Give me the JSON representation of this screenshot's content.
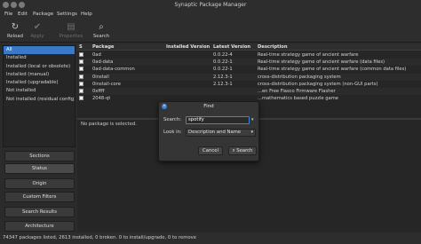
{
  "window": {
    "title": "Synaptic Package Manager"
  },
  "menu": [
    "File",
    "Edit",
    "Package",
    "Settings",
    "Help"
  ],
  "toolbar": {
    "reload": "Reload",
    "apply": "Apply",
    "properties": "Properties",
    "search": "Search"
  },
  "filters": [
    "All",
    "Installed",
    "Installed (local or obsolete)",
    "Installed (manual)",
    "Installed (upgradable)",
    "Not installed",
    "Not installed (residual config)"
  ],
  "left_buttons": [
    "Sections",
    "Status",
    "Origin",
    "Custom Filters",
    "Search Results",
    "Architecture"
  ],
  "table": {
    "headers": {
      "s": "S",
      "package": "Package",
      "installed": "Installed Version",
      "latest": "Latest Version",
      "description": "Description"
    },
    "rows": [
      {
        "package": "0ad",
        "installed": "",
        "latest": "0.0.22-4",
        "description": "Real-time strategy game of ancient warfare"
      },
      {
        "package": "0ad-data",
        "installed": "",
        "latest": "0.0.22-1",
        "description": "Real-time strategy game of ancient warfare (data files)"
      },
      {
        "package": "0ad-data-common",
        "installed": "",
        "latest": "0.0.22-1",
        "description": "Real-time strategy game of ancient warfare (common data files)"
      },
      {
        "package": "0install",
        "installed": "",
        "latest": "2.12.3-1",
        "description": "cross-distribution packaging system"
      },
      {
        "package": "0install-core",
        "installed": "",
        "latest": "2.12.3-1",
        "description": "cross-distribution packaging system (non-GUI parts)"
      },
      {
        "package": "0xffff",
        "installed": "",
        "latest": "",
        "description": "...en Free Fiasco Firmware Flasher"
      },
      {
        "package": "2048-qt",
        "installed": "",
        "latest": "",
        "description": "...mathematics based puzzle game"
      }
    ]
  },
  "description_pane": {
    "text": "No package is selected."
  },
  "status": {
    "text": "74347 packages listed, 2613 installed, 0 broken. 0 to install/upgrade, 0 to remove"
  },
  "find_dialog": {
    "title": "Find",
    "search_label": "Search:",
    "search_value": "spotify",
    "lookin_label": "Look in:",
    "lookin_value": "Description and Name",
    "cancel": "Cancel",
    "search_button": "Search"
  },
  "colors": {
    "accent": "#3a79c7",
    "background": "#2b2b2b"
  }
}
